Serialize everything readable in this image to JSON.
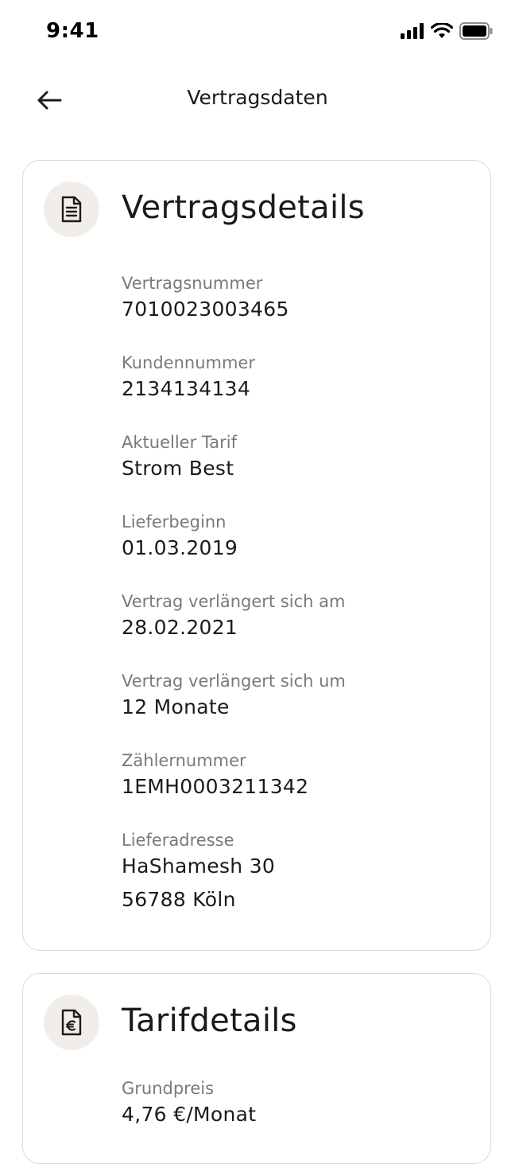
{
  "status_bar": {
    "time": "9:41"
  },
  "nav": {
    "title": "Vertragsdaten",
    "back_icon": "arrow-left-icon"
  },
  "contract_card": {
    "icon": "document-icon",
    "title": "Vertragsdetails",
    "fields": [
      {
        "label": "Vertragsnummer",
        "value": "7010023003465"
      },
      {
        "label": "Kundennummer",
        "value": "2134134134"
      },
      {
        "label": "Aktueller Tarif",
        "value": "Strom Best"
      },
      {
        "label": "Lieferbeginn",
        "value": "01.03.2019"
      },
      {
        "label": "Vertrag verlängert sich am",
        "value": "28.02.2021"
      },
      {
        "label": "Vertrag verlängert sich um",
        "value": "12 Monate"
      },
      {
        "label": "Zählernummer",
        "value": "1EMH0003211342"
      },
      {
        "label": "Lieferadresse",
        "value": "HaShamesh 30",
        "value2": "56788 Köln"
      }
    ]
  },
  "tariff_card": {
    "icon": "euro-document-icon",
    "title": "Tarifdetails",
    "fields": [
      {
        "label": "Grundpreis",
        "value": "4,76 €/Monat"
      }
    ]
  }
}
